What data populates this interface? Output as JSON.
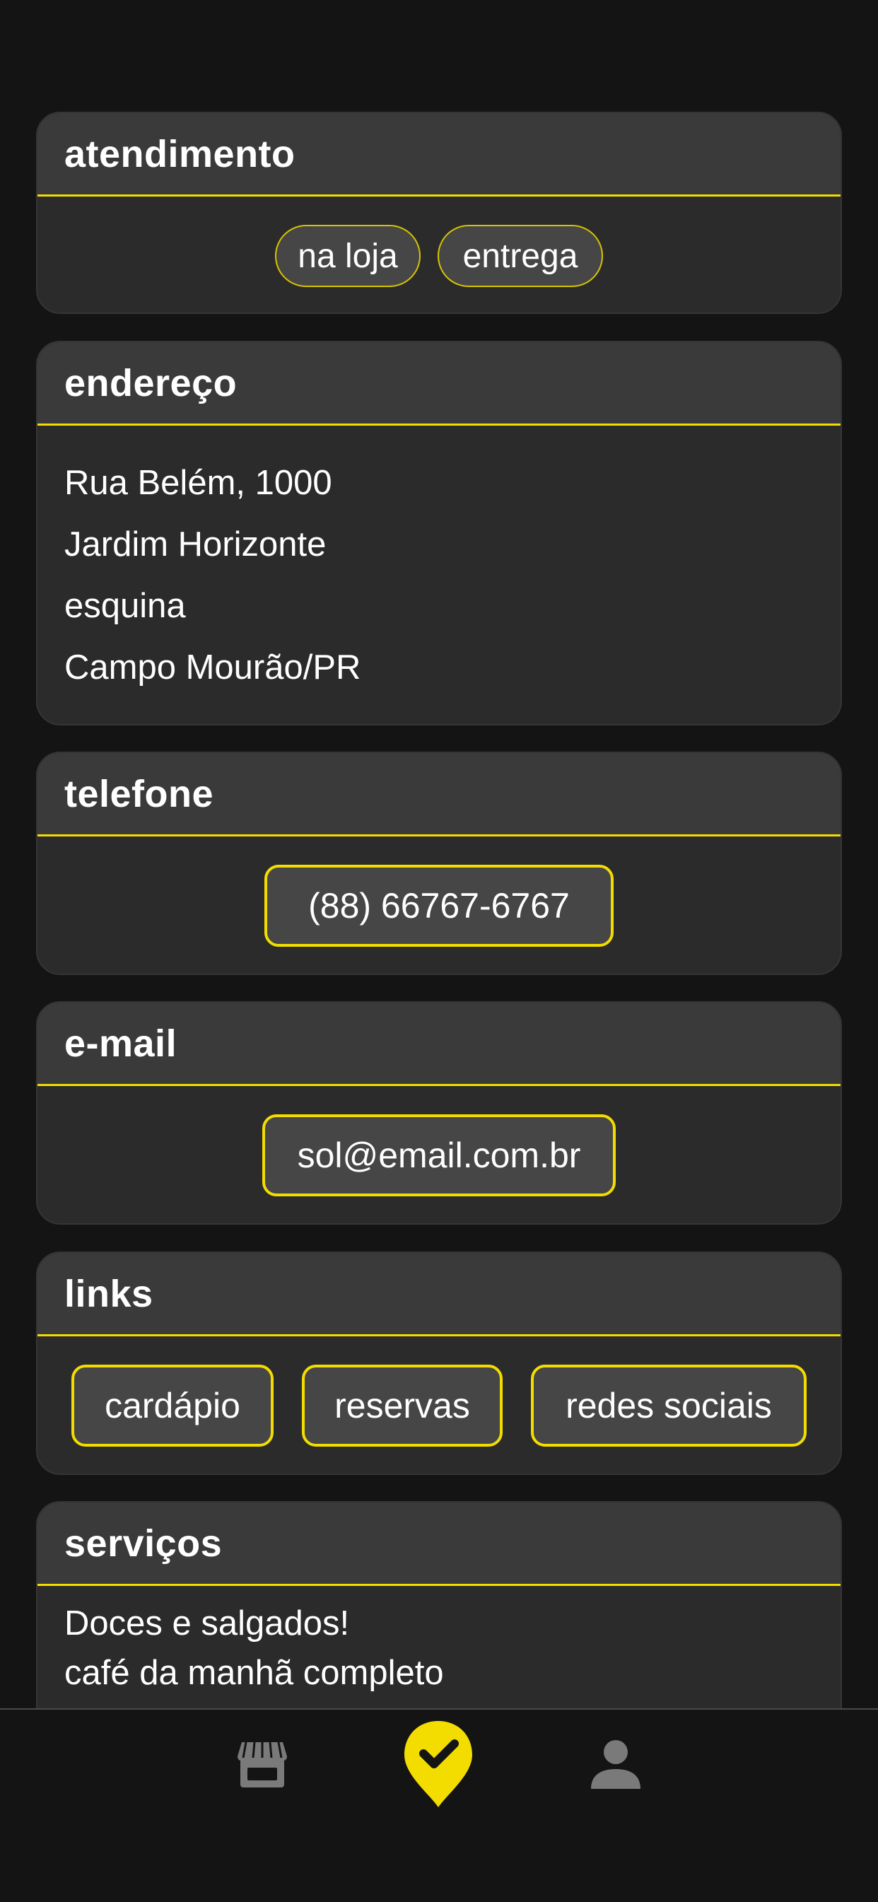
{
  "atendimento": {
    "title": "atendimento",
    "options": [
      "na loja",
      "entrega"
    ]
  },
  "endereco": {
    "title": "endereço",
    "lines": [
      "Rua Belém, 1000",
      "Jardim Horizonte",
      "esquina",
      "Campo Mourão/PR"
    ]
  },
  "telefone": {
    "title": "telefone",
    "number": "(88) 66767-6767"
  },
  "email": {
    "title": "e-mail",
    "address": "sol@email.com.br"
  },
  "links": {
    "title": "links",
    "items": [
      "cardápio",
      "reservas",
      "redes sociais"
    ]
  },
  "servicos": {
    "title": "serviços",
    "lines": [
      "Doces e salgados!",
      "café da manhã completo"
    ]
  },
  "bottom_nav": {
    "items": [
      {
        "icon": "store-icon",
        "active": false
      },
      {
        "icon": "location-check-icon",
        "active": true
      },
      {
        "icon": "user-icon",
        "active": false
      }
    ]
  },
  "colors": {
    "accent": "#f3dd00",
    "background": "#141414",
    "card": "#2b2b2b",
    "card_header": "#3a3a3a",
    "button": "#464646",
    "icon_inactive": "#7a7a7a"
  }
}
